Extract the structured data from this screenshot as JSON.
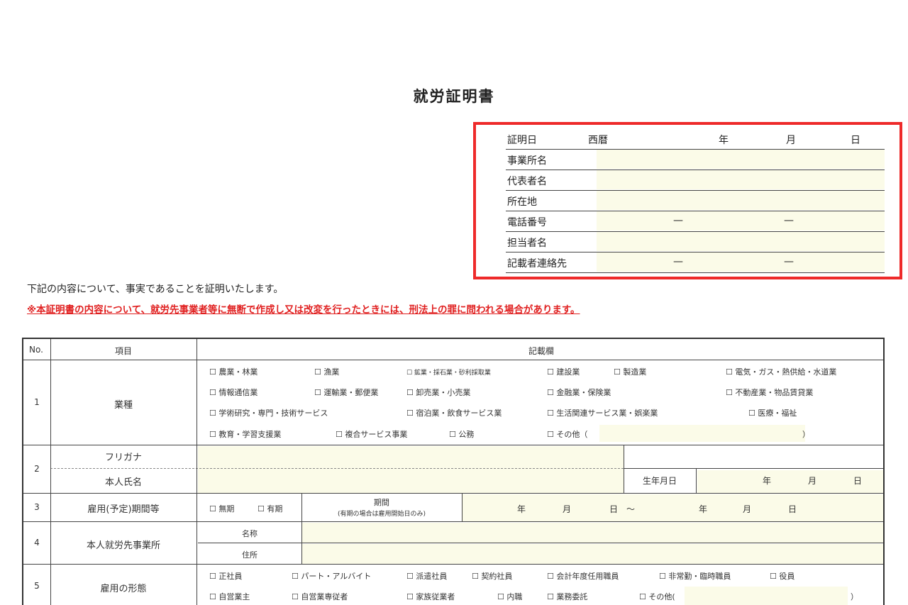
{
  "title": "就労証明書",
  "certifier": {
    "rows": [
      {
        "label": "証明日",
        "era": "西暦",
        "year": "年",
        "month": "月",
        "day": "日"
      },
      {
        "label": "事業所名"
      },
      {
        "label": "代表者名"
      },
      {
        "label": "所在地"
      },
      {
        "label": "電話番号",
        "sep1": "—",
        "sep2": "—"
      },
      {
        "label": "担当者名"
      },
      {
        "label": "記載者連絡先",
        "sep1": "—",
        "sep2": "—"
      }
    ]
  },
  "statement": "下記の内容について、事実であることを証明いたします。",
  "warning": "※本証明書の内容について、就労先事業者等に無断で作成し又は改変を行ったときには、刑法上の罪に問われる場合があります。",
  "table": {
    "headers": {
      "no": "No.",
      "item": "項目",
      "entry": "記載欄"
    },
    "row1": {
      "no": "1",
      "item": "業種",
      "options": [
        "☐ 農業・林業",
        "☐ 漁業",
        "☐ 鉱業・採石業・砂利採取業",
        "☐ 建設業",
        "☐ 製造業",
        "☐ 電気・ガス・熱供給・水道業",
        "☐ 情報通信業",
        "☐ 運輸業・郵便業",
        "☐ 卸売業・小売業",
        "☐ 金融業・保険業",
        "☐ 不動産業・物品賃貸業",
        "☐ 学術研究・専門・技術サービス",
        "☐ 宿泊業・飲食サービス業",
        "☐ 生活関連サービス業・娯楽業",
        "☐ 医療・福祉",
        "☐ 教育・学習支援業",
        "☐ 複合サービス事業",
        "☐ 公務",
        "☐ その他（"
      ],
      "close_paren": "）"
    },
    "row2": {
      "no": "2",
      "furigana": "フリガナ",
      "name": "本人氏名",
      "birth": "生年月日",
      "year": "年",
      "month": "月",
      "day": "日"
    },
    "row3": {
      "no": "3",
      "item": "雇用(予定)期間等",
      "opt_none": "☐ 無期",
      "opt_fixed": "☐ 有期",
      "period": "期間",
      "period_note": "(有期の場合は雇用開始日のみ)",
      "year": "年",
      "month": "月",
      "day": "日",
      "tilde": "～",
      "year2": "年",
      "month2": "月",
      "day2": "日"
    },
    "row4": {
      "no": "4",
      "item": "本人就労先事業所",
      "name_label": "名称",
      "address_label": "住所"
    },
    "row5": {
      "no": "5",
      "item": "雇用の形態",
      "options": [
        "☐ 正社員",
        "☐ パート・アルバイト",
        "☐ 派遣社員",
        "☐ 契約社員",
        "☐ 会計年度任用職員",
        "☐ 非常勤・臨時職員",
        "☐ 役員",
        "☐ 自営業主",
        "☐ 自営業専従者",
        "☐ 家族従業者",
        "☐ 内職",
        "☐ 業務委託",
        "☐ その他("
      ],
      "close_paren": "）"
    }
  }
}
